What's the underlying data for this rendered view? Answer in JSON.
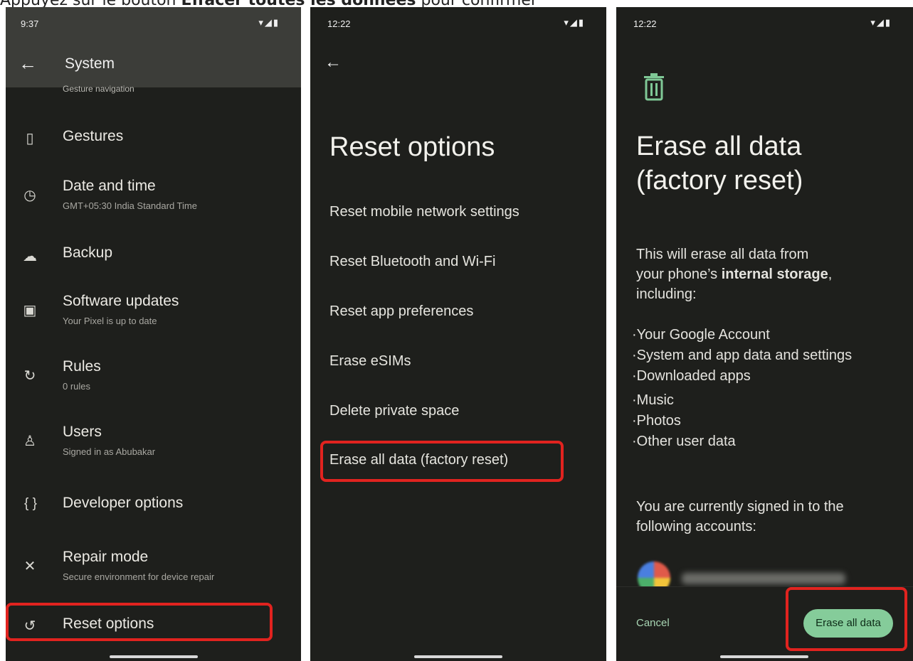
{
  "caption": {
    "prefix": "Appuyez sur le bouton ",
    "bold": "Effacer toutes les données",
    "suffix": " pour confirmer"
  },
  "panel1": {
    "time": "9:37",
    "status_icons": "▾◢▮",
    "title": "System",
    "partial_item": "Gesture navigation",
    "items": [
      {
        "title": "Gestures",
        "sub": ""
      },
      {
        "title": "Date and time",
        "sub": "GMT+05:30 India Standard Time"
      },
      {
        "title": "Backup",
        "sub": ""
      },
      {
        "title": "Software updates",
        "sub": "Your Pixel is up to date"
      },
      {
        "title": "Rules",
        "sub": "0 rules"
      },
      {
        "title": "Users",
        "sub": "Signed in as Abubakar"
      },
      {
        "title": "Developer options",
        "sub": ""
      },
      {
        "title": "Repair mode",
        "sub": "Secure environment for device repair"
      },
      {
        "title": "Reset options",
        "sub": ""
      }
    ],
    "icons": [
      "phone-gesture-icon",
      "clock-icon",
      "cloud-upload-icon",
      "system-update-icon",
      "rules-icon",
      "user-icon",
      "braces-icon",
      "tools-icon",
      "history-icon"
    ]
  },
  "panel2": {
    "time": "12:22",
    "status_icons": "▾◢▮",
    "title": "Reset options",
    "options": [
      "Reset mobile network settings",
      "Reset Bluetooth and Wi-Fi",
      "Reset app preferences",
      "Erase eSIMs",
      "Delete private space",
      "Erase all data (factory reset)"
    ]
  },
  "panel3": {
    "time": "12:22",
    "status_icons": "▾◢▮",
    "title_line1": "Erase all data",
    "title_line2": "(factory reset)",
    "intro_line1": "This will erase all data from",
    "intro_prefix": "your phone’s ",
    "intro_bold": "internal storage",
    "intro_suffix": ",",
    "intro_line3": "including:",
    "bullets": [
      "·Your Google Account",
      "·System and app data and settings",
      "·Downloaded apps",
      "·Music",
      "·Photos",
      "·Other user data"
    ],
    "signed_in_line1": "You are currently signed in to the",
    "signed_in_line2": "following accounts:",
    "cancel": "Cancel",
    "erase_button": "Erase all data"
  },
  "colors": {
    "highlight": "#e1231f",
    "accent_green": "#85cc9a",
    "background": "#1e1f1c"
  }
}
